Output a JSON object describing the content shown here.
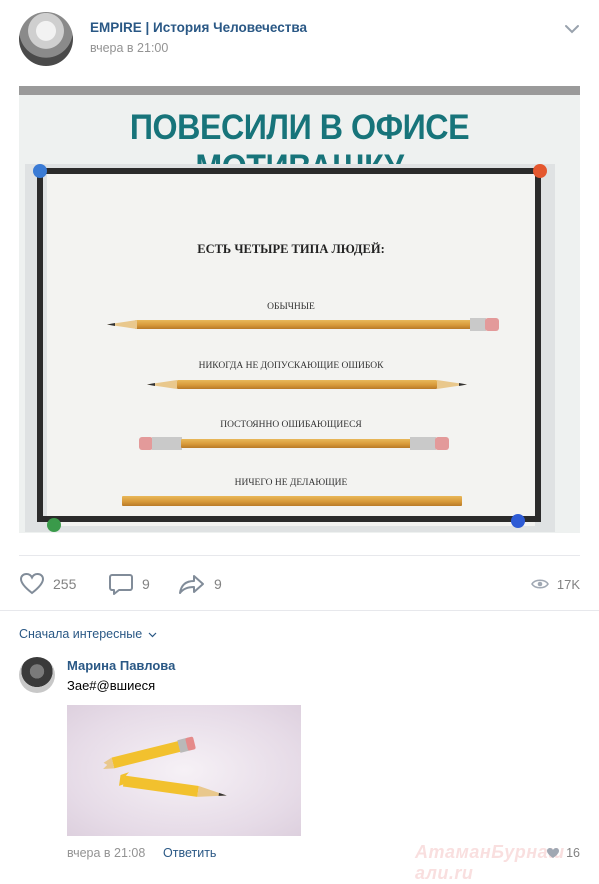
{
  "post": {
    "author": "EMPIRE | История Человечества",
    "time": "вчера в 21:00",
    "image": {
      "title": "ПОВЕСИЛИ В ОФИСЕ МОТИВАШКУ",
      "heading": "ЕСТЬ ЧЕТЫРЕ ТИПА ЛЮДЕЙ:",
      "labels": [
        "ОБЫЧНЫЕ",
        "НИКОГДА НЕ ДОПУСКАЮЩИЕ ОШИБОК",
        "ПОСТОЯННО ОШИБАЮЩИЕСЯ",
        "НИЧЕГО НЕ ДЕЛАЮЩИЕ"
      ]
    },
    "actions": {
      "likes": "255",
      "comments": "9",
      "shares": "9",
      "views": "17K"
    }
  },
  "comments": {
    "sort_label": "Сначала интересные",
    "items": [
      {
        "author": "Марина Павлова",
        "text": "Зае#@вшиеся",
        "time": "вчера в 21:08",
        "reply_label": "Ответить",
        "likes": "16"
      }
    ]
  },
  "watermark": "АтаманБурнаш али.ru",
  "colors": {
    "link": "#2a5885",
    "muted": "#939393",
    "title_teal": "#17747a"
  }
}
